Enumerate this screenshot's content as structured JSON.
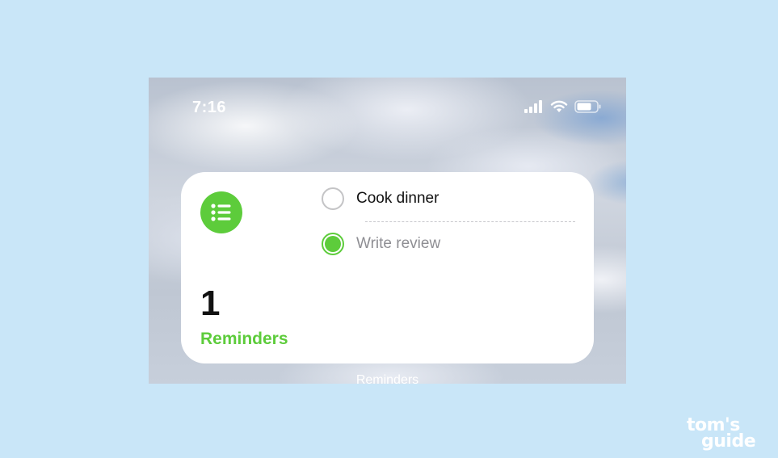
{
  "status_bar": {
    "time": "7:16",
    "icons": [
      "signal-icon",
      "wifi-icon",
      "battery-icon"
    ]
  },
  "widget": {
    "list_icon": "list-bullet-icon",
    "count": "1",
    "list_name": "Reminders",
    "items": [
      {
        "text": "Cook dinner",
        "completed": false
      },
      {
        "text": "Write review",
        "completed": true
      }
    ],
    "accent_color": "#5dcc3b"
  },
  "home_screen": {
    "widget_label": "Reminders"
  },
  "watermark": {
    "line1": "tom's",
    "line2": "guide"
  }
}
